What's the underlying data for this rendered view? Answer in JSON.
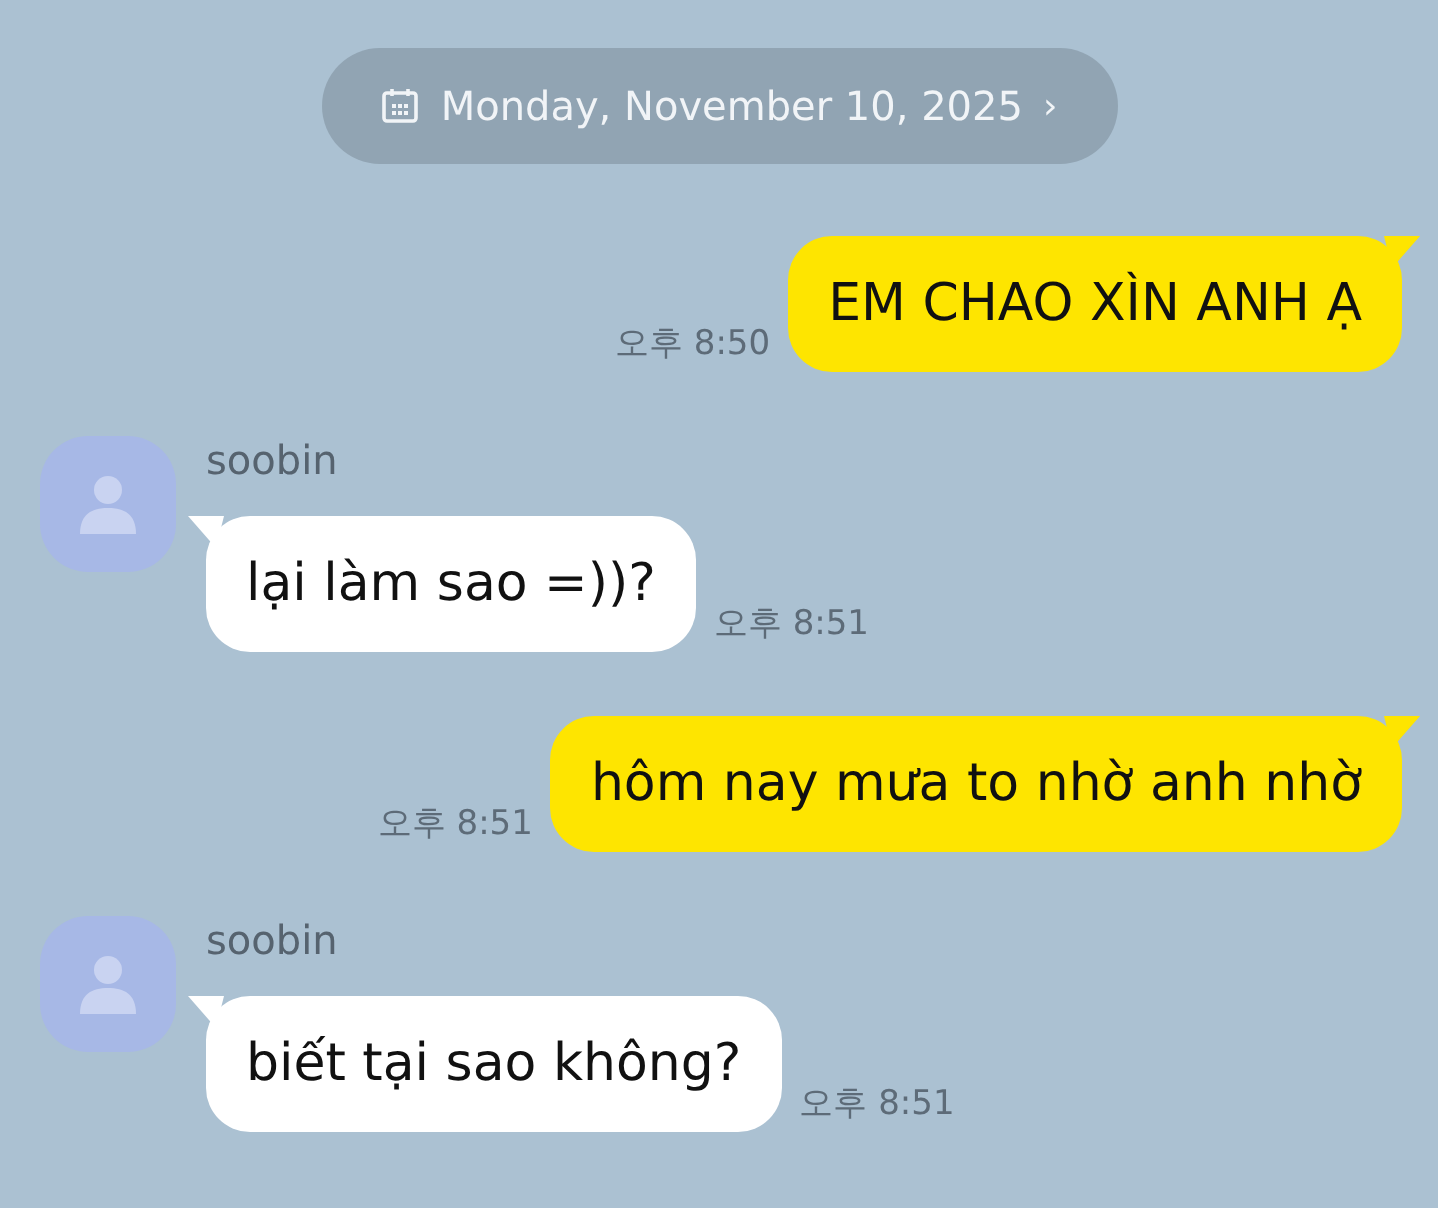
{
  "date_pill": {
    "label": "Monday, November 10, 2025",
    "chevron": "›"
  },
  "messages": [
    {
      "kind": "sent",
      "text": "EM CHAO XÌN ANH Ạ",
      "time": "오후 8:50"
    },
    {
      "kind": "received",
      "sender": "soobin",
      "text": "lại làm sao =))?",
      "time": "오후 8:51"
    },
    {
      "kind": "sent",
      "text": "hôm nay mưa to nhờ anh nhờ",
      "time": "오후 8:51"
    },
    {
      "kind": "received",
      "sender": "soobin",
      "text": "biết tại sao không?",
      "time": "오후 8:51"
    }
  ]
}
